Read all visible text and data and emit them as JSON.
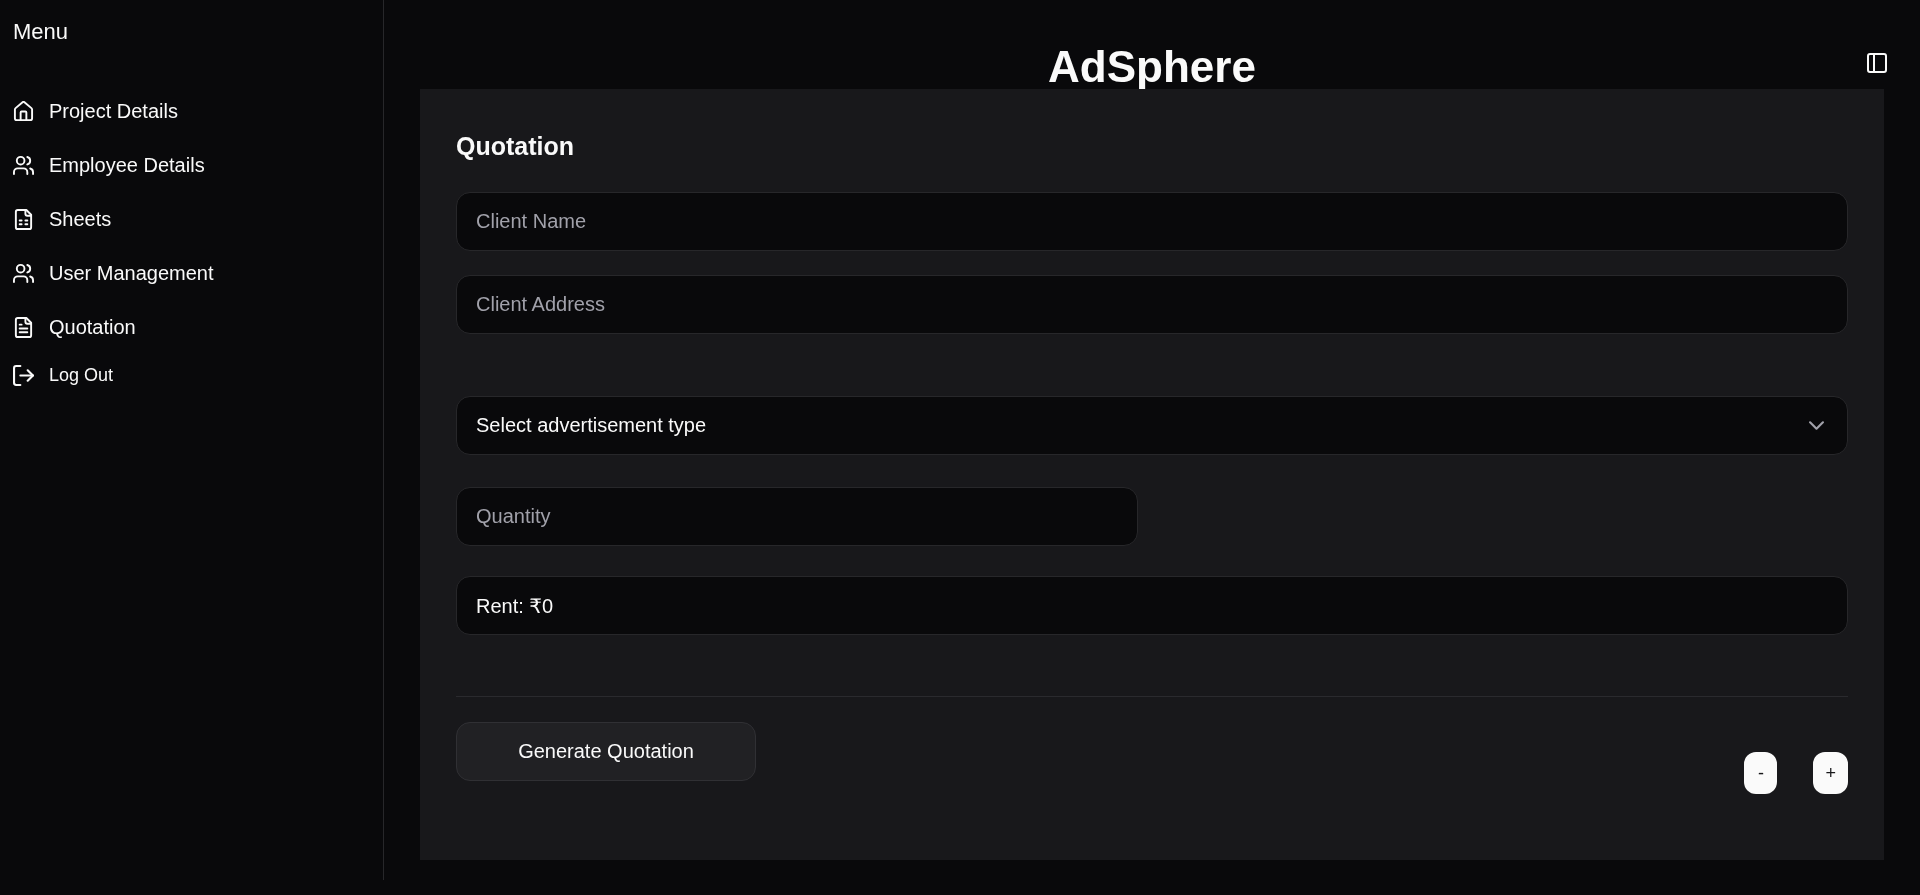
{
  "sidebar": {
    "title": "Menu",
    "items": [
      {
        "label": "Project Details"
      },
      {
        "label": "Employee Details"
      },
      {
        "label": "Sheets"
      },
      {
        "label": "User Management"
      },
      {
        "label": "Quotation"
      }
    ],
    "logout": {
      "label": "Log Out"
    }
  },
  "header": {
    "title": "AdSphere"
  },
  "form": {
    "title": "Quotation",
    "client_name": {
      "placeholder": "Client Name"
    },
    "client_address": {
      "placeholder": "Client Address"
    },
    "advertisement_type": {
      "value": "Select advertisement type"
    },
    "quantity": {
      "placeholder": "Quantity"
    },
    "rent": {
      "value": "Rent: ₹0"
    },
    "generate_button": {
      "label": "Generate Quotation"
    },
    "minus_button": {
      "label": "-"
    },
    "plus_button": {
      "label": "+"
    }
  }
}
